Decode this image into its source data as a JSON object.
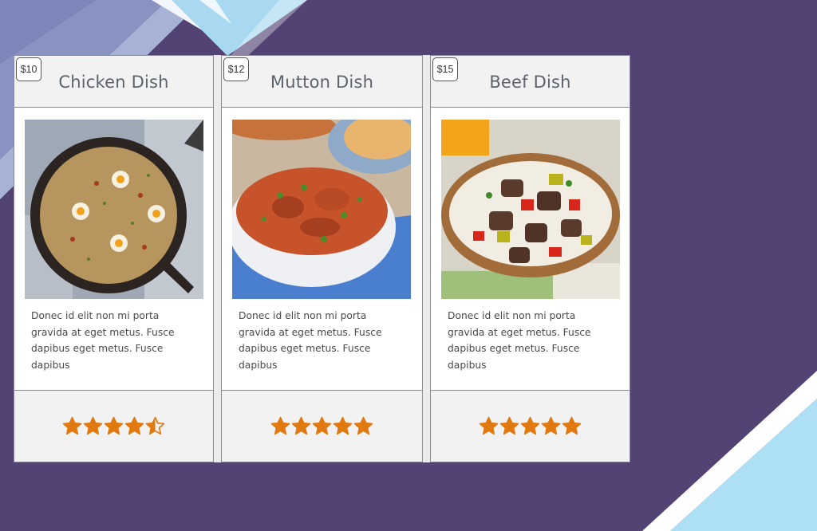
{
  "theme": {
    "accent": "#e07a10",
    "background": "#534274"
  },
  "cards": [
    {
      "price": "$10",
      "title": "Chicken Dish",
      "image_icon": "chicken-dish-photo",
      "description": "Donec id elit non mi porta gravida at eget metus. Fusce dapibus eget metus. Fusce dapibus",
      "rating": 4.5,
      "rating_max": 5
    },
    {
      "price": "$12",
      "title": "Mutton Dish",
      "image_icon": "mutton-dish-photo",
      "description": "Donec id elit non mi porta gravida at eget metus. Fusce dapibus eget metus. Fusce dapibus",
      "rating": 5,
      "rating_max": 5
    },
    {
      "price": "$15",
      "title": "Beef Dish",
      "image_icon": "beef-dish-photo",
      "description": "Donec id elit non mi porta gravida at eget metus. Fusce dapibus eget metus. Fusce dapibus",
      "rating": 5,
      "rating_max": 5
    }
  ]
}
